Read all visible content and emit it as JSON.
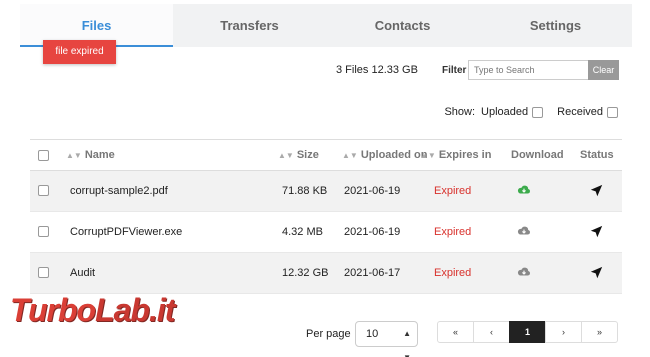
{
  "tabs": [
    {
      "label": "Files",
      "active": true
    },
    {
      "label": "Transfers",
      "active": false
    },
    {
      "label": "Contacts",
      "active": false
    },
    {
      "label": "Settings",
      "active": false
    }
  ],
  "toast": {
    "text": "file expired",
    "color": "#e74540"
  },
  "summary": "3 Files 12.33 GB",
  "filter": {
    "label": "Filter",
    "placeholder": "Type to Search",
    "value": "",
    "clear_label": "Clear"
  },
  "show": {
    "label": "Show:",
    "uploaded_label": "Uploaded",
    "received_label": "Received",
    "uploaded_checked": false,
    "received_checked": false
  },
  "table": {
    "columns": [
      "Name",
      "Size",
      "Uploaded on",
      "Expires in",
      "Download",
      "Status"
    ],
    "rows": [
      {
        "name": "corrupt-sample2.pdf",
        "size": "71.88 KB",
        "uploaded": "2021-06-19",
        "expires": "Expired",
        "download_icon": "cloud-download-icon",
        "download_color": "#3cab4c",
        "status_icon": "send-icon"
      },
      {
        "name": "CorruptPDFViewer.exe",
        "size": "4.32 MB",
        "uploaded": "2021-06-19",
        "expires": "Expired",
        "download_icon": "cloud-download-icon",
        "download_color": "#888888",
        "status_icon": "send-icon"
      },
      {
        "name": "Audit",
        "size": "12.32 GB",
        "uploaded": "2021-06-17",
        "expires": "Expired",
        "download_icon": "cloud-download-icon",
        "download_color": "#888888",
        "status_icon": "send-icon"
      }
    ]
  },
  "pagination": {
    "per_page_label": "Per page",
    "per_page_value": "10",
    "buttons": [
      "«",
      "‹",
      "1",
      "›",
      "»"
    ],
    "current_page": "1"
  },
  "watermark": {
    "part1": "Turbo",
    "part2": "Lab.it"
  },
  "colors": {
    "accent": "#3b8ed8",
    "expired": "#d8312c",
    "tab_bg": "#f1f2f3"
  }
}
